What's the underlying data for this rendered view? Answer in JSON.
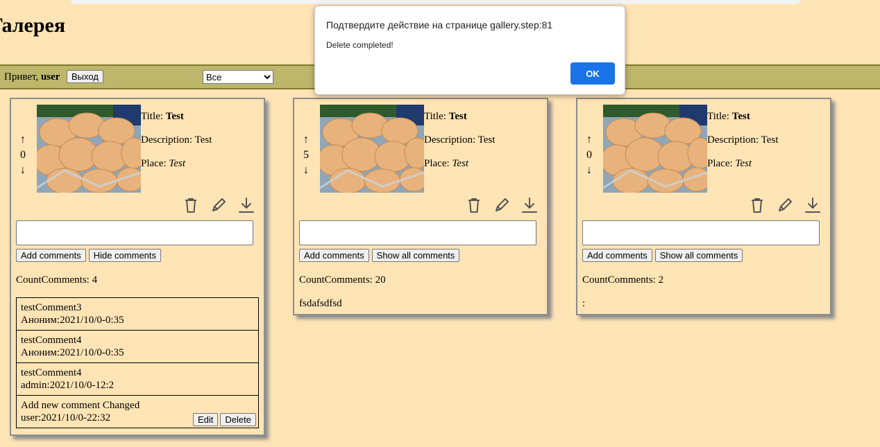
{
  "header": {
    "title": "Галерея"
  },
  "nav": {
    "greeting": "Привет, ",
    "username": "user",
    "logout_label": "Выход",
    "filter_selected": "Все"
  },
  "labels": {
    "title": "Title: ",
    "description": "Description: ",
    "place": "Place: ",
    "add_comments": "Add comments",
    "count_prefix": "CountComments: ",
    "edit": "Edit",
    "delete": "Delete"
  },
  "cards": [
    {
      "votes": "0",
      "title": "Test",
      "description": "Test",
      "place": "Test",
      "toggle_label": "Hide comments",
      "count": "4",
      "comments": [
        {
          "text": "testComment3",
          "meta": "Аноним:2021/10/0-0:35"
        },
        {
          "text": "testComment4",
          "meta": "Аноним:2021/10/0-0:35"
        },
        {
          "text": "testComment4",
          "meta": "admin:2021/10/0-12:2"
        },
        {
          "text": "Add new comment Changed",
          "meta": "user:2021/10/0-22:32"
        }
      ]
    },
    {
      "votes": "5",
      "title": "Test",
      "description": "Test",
      "place": "Test",
      "toggle_label": "Show all comments",
      "count": "20",
      "last_comment": "fsdafsdfsd"
    },
    {
      "votes": "0",
      "title": "Test",
      "description": "Test",
      "place": "Test",
      "toggle_label": "Show all comments",
      "count": "2",
      "last_comment": ":"
    }
  ],
  "dialog": {
    "title": "Подтвердите действие на странице gallery.step:81",
    "message": "Delete completed!",
    "ok_label": "OK"
  },
  "icons": [
    "up-arrow-icon",
    "down-arrow-icon",
    "trash-icon",
    "pencil-icon",
    "download-icon"
  ],
  "colors": {
    "background": "#ffe4b5",
    "navbar": "#bdb76b",
    "ok_button": "#1a73e8"
  }
}
